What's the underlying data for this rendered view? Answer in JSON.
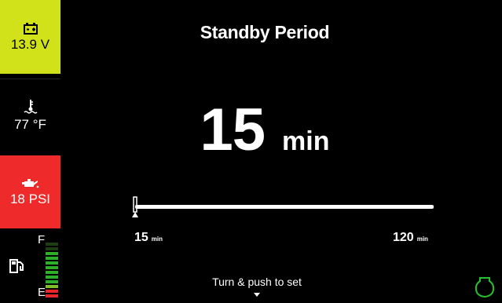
{
  "sidebar": {
    "battery": {
      "icon": "battery-icon",
      "value": "13.9 V",
      "color": "#d2e21a"
    },
    "temperature": {
      "icon": "coolant-temperature-icon",
      "value": "77 °F"
    },
    "oil": {
      "icon": "oil-pressure-icon",
      "value": "18 PSI",
      "color": "#ef2a2a"
    },
    "fuel": {
      "icon": "fuel-pump-icon",
      "full_label": "F",
      "empty_label": "E",
      "level": 0.83
    }
  },
  "main": {
    "title": "Standby Period",
    "value": "15",
    "unit": "min",
    "slider": {
      "current": 15,
      "min": 15,
      "max": 120
    },
    "min_label": {
      "value": "15",
      "unit": "min"
    },
    "max_label": {
      "value": "120",
      "unit": "min"
    },
    "hint": "Turn & push to set",
    "hint_icon": "down-arrow-icon",
    "corner_icon": "engine-outline-icon"
  }
}
